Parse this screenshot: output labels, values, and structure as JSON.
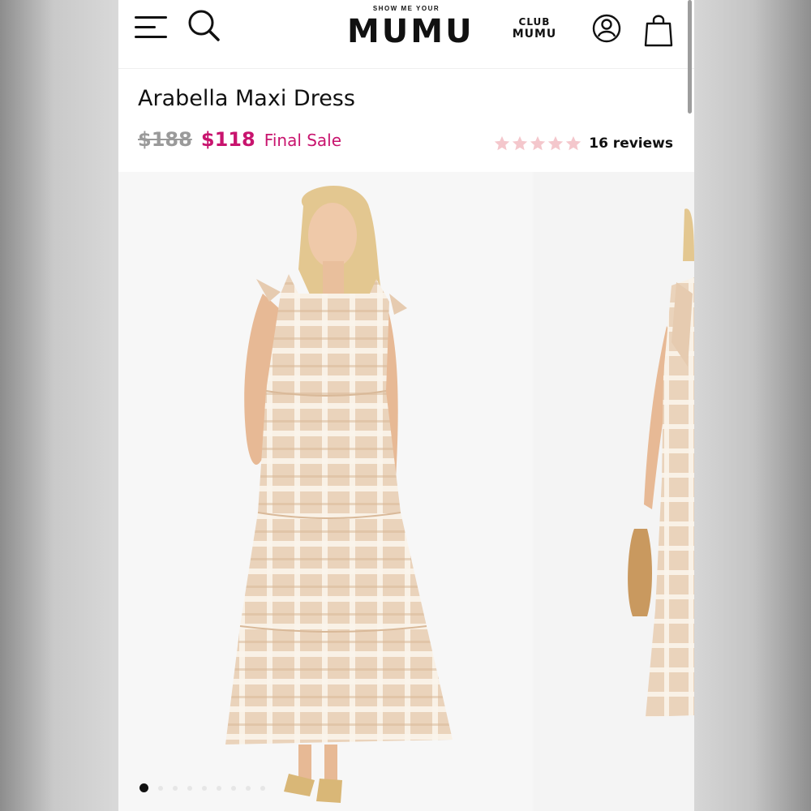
{
  "header": {
    "logo_small": "SHOW ME YOUR",
    "logo_big": "MUMU",
    "club_line1": "CLUB",
    "club_line2": "MUMU",
    "icons": [
      "menu-icon",
      "search-icon",
      "account-icon",
      "shopping-bag-icon"
    ]
  },
  "product": {
    "title": "Arabella Maxi Dress",
    "price_original": "$188",
    "price_sale": "$118",
    "sale_label": "Final Sale",
    "rating": 5,
    "reviews_text": "16 reviews"
  },
  "gallery": {
    "images": [
      {
        "description": "model-front-view",
        "alt": "Arabella Maxi Dress front"
      },
      {
        "description": "model-side-view",
        "alt": "Arabella Maxi Dress side"
      }
    ],
    "dot_count": 9,
    "active_index": 0
  },
  "colors": {
    "sale": "#c8146e",
    "strikethrough": "#9a9a9a",
    "star": "#f4c7cc",
    "text": "#111111",
    "plaid_tan": "#e2c6a8"
  }
}
